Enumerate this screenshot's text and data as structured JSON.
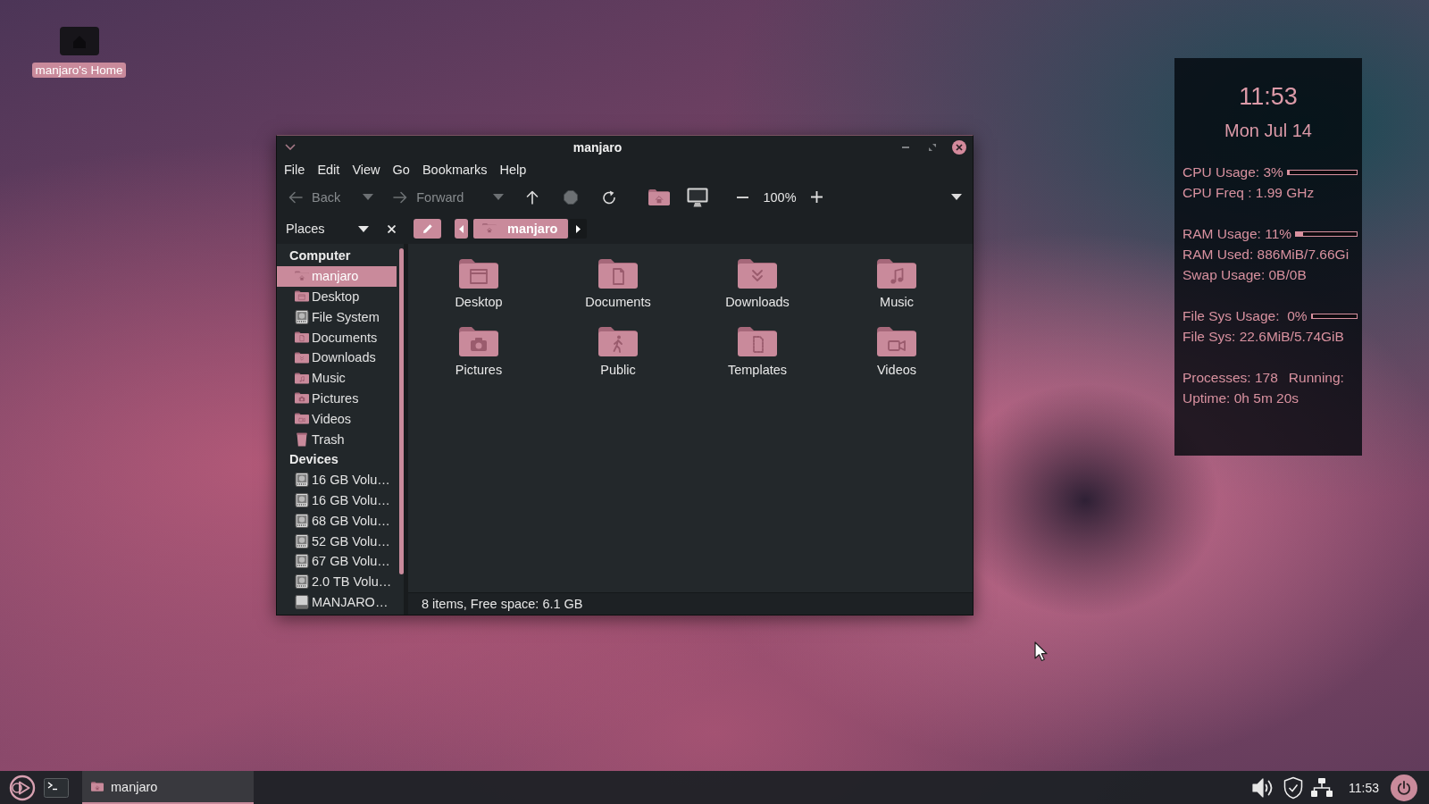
{
  "desktop_icons": [
    {
      "label": "manjaro's Home"
    }
  ],
  "window": {
    "title": "manjaro",
    "menu": [
      "File",
      "Edit",
      "View",
      "Go",
      "Bookmarks",
      "Help"
    ],
    "toolbar": {
      "back": {
        "label": "Back",
        "disabled": true
      },
      "forward": {
        "label": "Forward",
        "disabled": true
      },
      "up": {
        "disabled": false
      },
      "stop": {
        "disabled": true
      },
      "reload": {
        "disabled": false
      },
      "zoom": "100%"
    },
    "sidebar": {
      "mode": "Places",
      "sections": [
        {
          "heading": "Computer",
          "items": [
            {
              "label": "manjaro",
              "kind": "home",
              "selected": true
            },
            {
              "label": "Desktop",
              "kind": "desktop",
              "selected": false
            },
            {
              "label": "File System",
              "kind": "drive",
              "selected": false
            },
            {
              "label": "Documents",
              "kind": "documents",
              "selected": false
            },
            {
              "label": "Downloads",
              "kind": "downloads",
              "selected": false
            },
            {
              "label": "Music",
              "kind": "music",
              "selected": false
            },
            {
              "label": "Pictures",
              "kind": "pictures",
              "selected": false
            },
            {
              "label": "Videos",
              "kind": "videos",
              "selected": false
            },
            {
              "label": "Trash",
              "kind": "trash",
              "selected": false
            }
          ]
        },
        {
          "heading": "Devices",
          "items": [
            {
              "label": "16 GB Volu…",
              "kind": "drive",
              "selected": false
            },
            {
              "label": "16 GB Volu…",
              "kind": "drive",
              "selected": false
            },
            {
              "label": "68 GB Volu…",
              "kind": "drive",
              "selected": false
            },
            {
              "label": "52 GB Volu…",
              "kind": "drive",
              "selected": false
            },
            {
              "label": "67 GB Volu…",
              "kind": "drive",
              "selected": false
            },
            {
              "label": "2.0 TB Volu…",
              "kind": "drive",
              "selected": false
            },
            {
              "label": "MANJARO…",
              "kind": "removable",
              "selected": false
            }
          ]
        }
      ]
    },
    "path": [
      {
        "label": "manjaro",
        "selected": true
      }
    ],
    "files": [
      {
        "label": "Desktop",
        "kind": "desktop",
        "selected": false
      },
      {
        "label": "Documents",
        "kind": "documents",
        "selected": false
      },
      {
        "label": "Downloads",
        "kind": "downloads",
        "selected": false
      },
      {
        "label": "Music",
        "kind": "music",
        "selected": false
      },
      {
        "label": "Pictures",
        "kind": "pictures",
        "selected": false
      },
      {
        "label": "Public",
        "kind": "public",
        "selected": false
      },
      {
        "label": "Templates",
        "kind": "templates",
        "selected": false
      },
      {
        "label": "Videos",
        "kind": "videos",
        "selected": false
      }
    ],
    "status": "8 items, Free space: 6.1 GB"
  },
  "system_monitor": {
    "time": "11:53",
    "date": "Mon Jul 14",
    "groups": [
      {
        "lines": [
          {
            "kind": "meter",
            "text": "CPU Usage: 3%",
            "level": 0.03
          },
          {
            "kind": "text",
            "text": "CPU Freq : 1.99 GHz"
          }
        ]
      },
      {
        "lines": [
          {
            "kind": "meter",
            "text": "RAM Usage: 11%",
            "level": 0.11
          },
          {
            "kind": "text",
            "text": "RAM Used: 886MiB/7.66Gi"
          },
          {
            "kind": "text",
            "text": "Swap Usage: 0B/0B"
          }
        ]
      },
      {
        "lines": [
          {
            "kind": "meter",
            "text": "File Sys Usage:  0%",
            "level": 0
          },
          {
            "kind": "text",
            "text": "File Sys: 22.6MiB/5.74GiB"
          }
        ]
      },
      {
        "lines": [
          {
            "kind": "pair",
            "texts": [
              "Processes: 178",
              "Running:"
            ]
          },
          {
            "kind": "text",
            "text": "Uptime: 0h 5m 20s"
          }
        ]
      }
    ]
  },
  "taskbar": {
    "tasks": [
      {
        "label": "manjaro",
        "selected": true
      }
    ],
    "clock": "11:53"
  }
}
